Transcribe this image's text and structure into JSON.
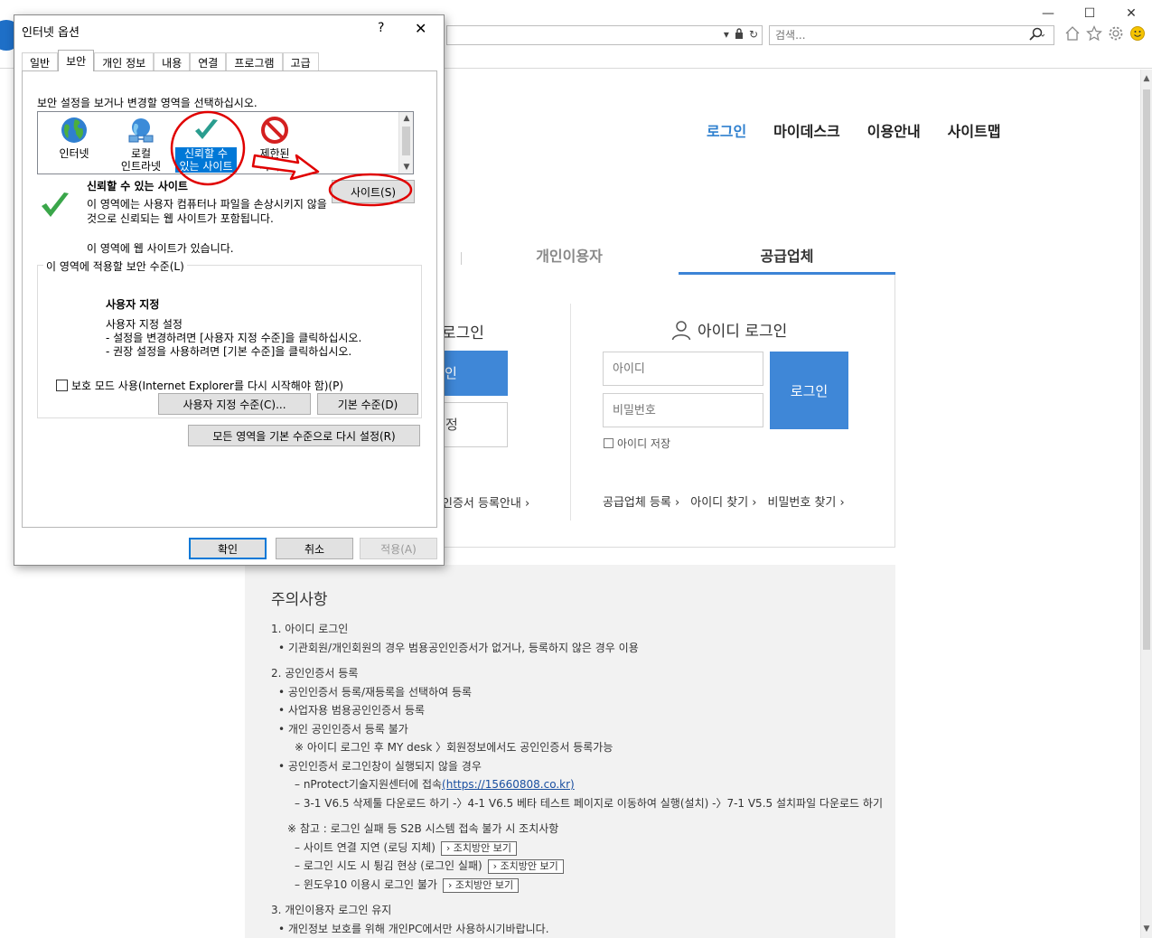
{
  "browser": {
    "window_buttons": [
      "—",
      "☐",
      "✕"
    ],
    "address_icons": [
      "▾",
      "🔒",
      "↻"
    ],
    "search_placeholder": "검색...",
    "search_icon": "⚲",
    "search_dropdown": "▾",
    "tool_icons": [
      "home-icon",
      "star-icon",
      "gear-icon",
      "smiley-icon"
    ]
  },
  "site": {
    "gnb": [
      "로그인",
      "마이데스크",
      "이용안내",
      "사이트맵"
    ],
    "tabs": [
      "개인이용자",
      "공급업체"
    ],
    "cert_title": "로그인",
    "cert_btn1": "인",
    "cert_btn2": "정",
    "cert_link": "인증서 등록안내 ›",
    "id_title": "아이디 로그인",
    "id_placeholder": "아이디",
    "pw_placeholder": "비밀번호",
    "login_button": "로그인",
    "save_id": "아이디 저장",
    "links": [
      "공급업체 등록 ›",
      "아이디 찾기 ›",
      "비밀번호 찾기 ›"
    ]
  },
  "notice": {
    "title": "주의사항",
    "s1_title": "1. 아이디 로그인",
    "s1_items": [
      "• 기관회원/개인회원의 경우 범용공인인증서가 없거나, 등록하지 않은 경우 이용"
    ],
    "s2_title": "2. 공인인증서 등록",
    "s2_items": [
      "• 공인인증서 등록/재등록을 선택하여 등록",
      "• 사업자용 범용공인인증서 등록",
      "• 개인 공인인증서 등록 불가"
    ],
    "s2_note": "※ 아이디 로그인 후 MY desk 〉회원정보에서도 공인인증서 등록가능",
    "s2_item4": "• 공인인증서 로그인창이 실행되지 않을 경우",
    "s2_sub1_prefix": "– nProtect기술지원센터에 접속",
    "s2_sub1_link": "(https://15660808.co.kr)",
    "s2_sub2": "– 3-1 V6.5 삭제툴 다운로드 하기 -〉4-1 V6.5 베타 테스트 페이지로 이동하여 실행(설치) -〉7-1 V5.5 설치파일 다운로드 하기",
    "ref_title": "※ 참고 : 로그인 실패 등 S2B 시스템 접속 불가 시 조치사항",
    "ref_items": [
      "– 사이트 연결 지연 (로딩 지체)",
      "– 로그인 시도 시 튕김 현상 (로그인 실패)",
      "– 윈도우10 이용시 로그인 불가"
    ],
    "solve_label": "› 조치방안 보기",
    "s3_title": "3. 개인이용자 로그인 유지",
    "s3_items": [
      "• 개인정보 보호를 위해 개인PC에서만 사용하시기바랍니다."
    ]
  },
  "dialog": {
    "title": "인터넷 옵션",
    "help": "?",
    "close": "✕",
    "tabs": [
      "일반",
      "보안",
      "개인 정보",
      "내용",
      "연결",
      "프로그램",
      "고급"
    ],
    "active_tab": "보안",
    "zone_prompt": "보안 설정을 보거나 변경할 영역을 선택하십시오.",
    "zones": [
      {
        "line1": "인터넷",
        "line2": "",
        "icon": "globe-icon"
      },
      {
        "line1": "로컬",
        "line2": "인트라넷",
        "icon": "network-icon"
      },
      {
        "line1": "신뢰할 수",
        "line2": "있는 사이트",
        "icon": "checkmark-icon"
      },
      {
        "line1": "제한된",
        "line2": "사이트",
        "icon": "restricted-icon"
      }
    ],
    "selected_zone_title": "신뢰할 수 있는 사이트",
    "selected_zone_desc": "이 영역에는 사용자 컴퓨터나 파일을 손상시키지 않을 것으로 신뢰되는 웹 사이트가 포함됩니다.",
    "zone_has_sites": "이 영역에 웹 사이트가 있습니다.",
    "sites_button": "사이트(S)",
    "level_group": "이 영역에 적용할 보안 수준(L)",
    "level_title": "사용자 지정",
    "level_desc": [
      "사용자 지정 설정",
      "- 설정을 변경하려면 [사용자 지정 수준]을 클릭하십시오.",
      "- 권장 설정을 사용하려면 [기본 수준]을 클릭하십시오."
    ],
    "protected_mode": "보호 모드 사용(Internet Explorer를 다시 시작해야 함)(P)",
    "custom_level_button": "사용자 지정 수준(C)...",
    "default_level_button": "기본 수준(D)",
    "reset_all_button": "모든 영역을 기본 수준으로 다시 설정(R)",
    "ok_button": "확인",
    "cancel_button": "취소",
    "apply_button": "적용(A)"
  },
  "colors": {
    "accent_blue": "#3f87d7",
    "annotation_red": "#e00000",
    "selected_zone": "#0078d7"
  }
}
